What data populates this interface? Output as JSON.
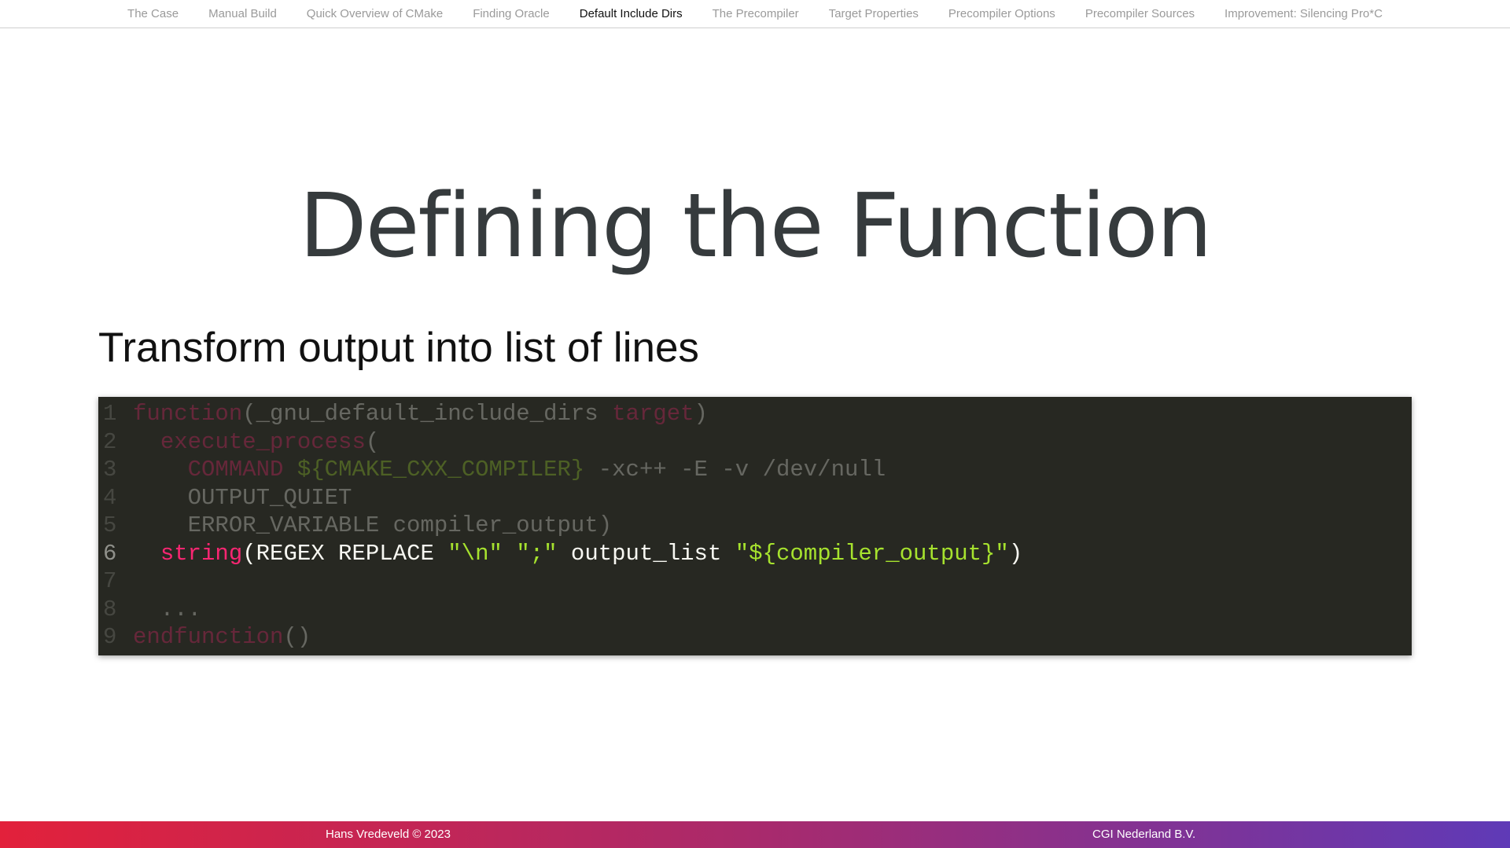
{
  "nav": {
    "items": [
      {
        "label": "The Case",
        "active": false
      },
      {
        "label": "Manual Build",
        "active": false
      },
      {
        "label": "Quick Overview of CMake",
        "active": false
      },
      {
        "label": "Finding Oracle",
        "active": false
      },
      {
        "label": "Default Include Dirs",
        "active": true
      },
      {
        "label": "The Precompiler",
        "active": false
      },
      {
        "label": "Target Properties",
        "active": false
      },
      {
        "label": "Precompiler Options",
        "active": false
      },
      {
        "label": "Precompiler Sources",
        "active": false
      },
      {
        "label": "Improvement: Silencing Pro*C",
        "active": false
      }
    ]
  },
  "slide": {
    "title": "Defining the Function",
    "subheading": "Transform output into list of lines"
  },
  "code": {
    "highlighted_line": 6,
    "lines": [
      {
        "n": "1",
        "tokens": [
          [
            "kw",
            "function"
          ],
          [
            "txt",
            "(_gnu_default_include_dirs "
          ],
          [
            "kw",
            "target"
          ],
          [
            "txt",
            ")"
          ]
        ]
      },
      {
        "n": "2",
        "tokens": [
          [
            "txt",
            "  "
          ],
          [
            "kw",
            "execute_process"
          ],
          [
            "txt",
            "("
          ]
        ]
      },
      {
        "n": "3",
        "tokens": [
          [
            "txt",
            "    "
          ],
          [
            "kw",
            "COMMAND"
          ],
          [
            "txt",
            " "
          ],
          [
            "var",
            "${CMAKE_CXX_COMPILER}"
          ],
          [
            "txt",
            " -xc++ -E -v /dev/null"
          ]
        ]
      },
      {
        "n": "4",
        "tokens": [
          [
            "txt",
            "    OUTPUT_QUIET"
          ]
        ]
      },
      {
        "n": "5",
        "tokens": [
          [
            "txt",
            "    ERROR_VARIABLE compiler_output)"
          ]
        ]
      },
      {
        "n": "6",
        "tokens": [
          [
            "txt",
            "  "
          ],
          [
            "kw",
            "string"
          ],
          [
            "txt",
            "(REGEX REPLACE "
          ],
          [
            "str",
            "\"\\n\""
          ],
          [
            "txt",
            " "
          ],
          [
            "str",
            "\";\""
          ],
          [
            "txt",
            " output_list "
          ],
          [
            "str",
            "\"${compiler_output}\""
          ],
          [
            "txt",
            ")"
          ]
        ]
      },
      {
        "n": "7",
        "tokens": []
      },
      {
        "n": "8",
        "tokens": [
          [
            "txt",
            "  ..."
          ]
        ]
      },
      {
        "n": "9",
        "tokens": [
          [
            "kw",
            "endfunction"
          ],
          [
            "txt",
            "()"
          ]
        ]
      }
    ]
  },
  "footer": {
    "author": "Hans Vredeveld © 2023",
    "company": "CGI Nederland B.V."
  },
  "colors": {
    "code_background": "#272822",
    "keyword": "#f92672",
    "string": "#a6e22e",
    "title_text": "#363b3d",
    "footer_gradient_start": "#e2213b",
    "footer_gradient_end": "#5f3ab7"
  }
}
